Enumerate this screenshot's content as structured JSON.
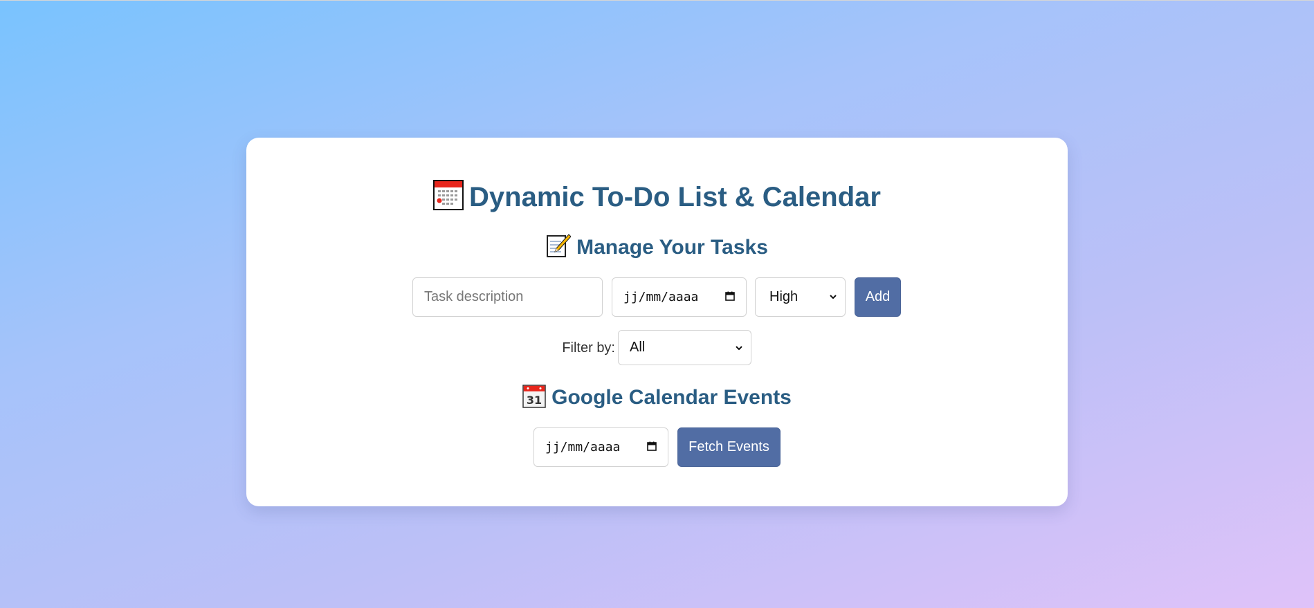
{
  "header": {
    "title": "Dynamic To-Do List & Calendar",
    "title_icon": "calendar-icon"
  },
  "tasks": {
    "heading": "Manage Your Tasks",
    "heading_icon": "memo-icon",
    "description_placeholder": "Task description",
    "date_placeholder": "jj/mm/aaaa",
    "priority_selected": "High",
    "add_label": "Add"
  },
  "filter": {
    "label": "Filter by:",
    "selected": "All"
  },
  "events": {
    "heading": "Google Calendar Events",
    "heading_icon": "calendar-31-icon",
    "date_placeholder": "jj/mm/aaaa",
    "fetch_label": "Fetch Events"
  },
  "colors": {
    "heading": "#2a5d83",
    "button": "#516da4",
    "card": "#ffffff"
  }
}
